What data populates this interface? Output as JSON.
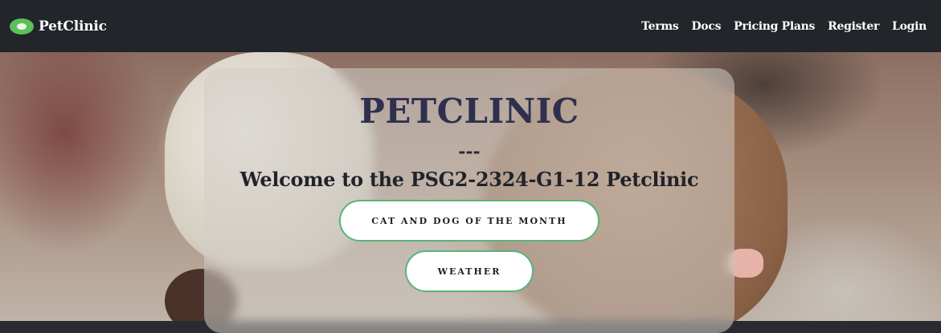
{
  "navbar": {
    "brand": "PetClinic",
    "logo_icon": "paw-logo-icon",
    "links": [
      "Terms",
      "Docs",
      "Pricing Plans",
      "Register",
      "Login"
    ]
  },
  "hero": {
    "title": "PETCLINIC",
    "separator": "---",
    "welcome": "Welcome to the PSG2-2324-G1-12 Petclinic",
    "buttons": {
      "month": "CAT AND DOG OF THE MONTH",
      "weather": "WEATHER"
    }
  },
  "colors": {
    "navbar_bg": "#22252a",
    "title": "#2f3050",
    "button_border": "#59b47a",
    "logo": "#5bbf5b"
  }
}
